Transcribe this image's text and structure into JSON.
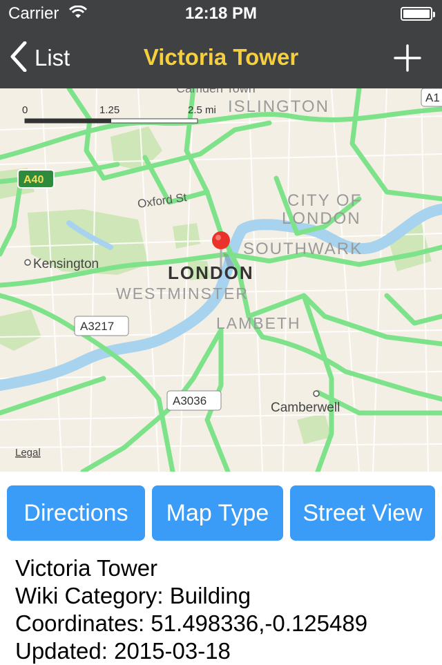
{
  "status_bar": {
    "carrier": "Carrier",
    "time": "12:18 PM",
    "battery_level": 1.0
  },
  "nav": {
    "back_label": "List",
    "title": "Victoria Tower",
    "add_icon": "plus-icon",
    "back_icon": "chevron-left-icon",
    "title_color": "#f6cf3c",
    "bar_color": "#3f4143"
  },
  "map": {
    "scale": {
      "labels": [
        "0",
        "1.25",
        "2.5 mi"
      ]
    },
    "labels": {
      "camden_town": "Camden Town",
      "islington": "ISLINGTON",
      "a1": "A1",
      "a40": "A40",
      "oxford_st": "Oxford St",
      "city_of": "CITY OF",
      "london_city": "LONDON",
      "southwark": "SOUTHWARK",
      "kensington": "Kensington",
      "london": "LONDON",
      "westminster": "WESTMINSTER",
      "a3217": "A3217",
      "lambeth": "LAMBETH",
      "a3036": "A3036",
      "camberwell": "Camberwell",
      "legal": "Legal"
    },
    "pin_icon": "map-pin-icon",
    "pin_color": "#e8322b",
    "road_color": "#7ee28a",
    "water_color": "#a7d3ee",
    "park_color": "#cfe6b8"
  },
  "buttons": {
    "directions": "Directions",
    "map_type": "Map Type",
    "street_view": "Street View",
    "color": "#3b9cf7"
  },
  "info": {
    "name": "Victoria Tower",
    "category": "Wiki Category: Building",
    "coordinates": "Coordinates: 51.498336,-0.125489",
    "updated": "Updated: 2015-03-18"
  }
}
